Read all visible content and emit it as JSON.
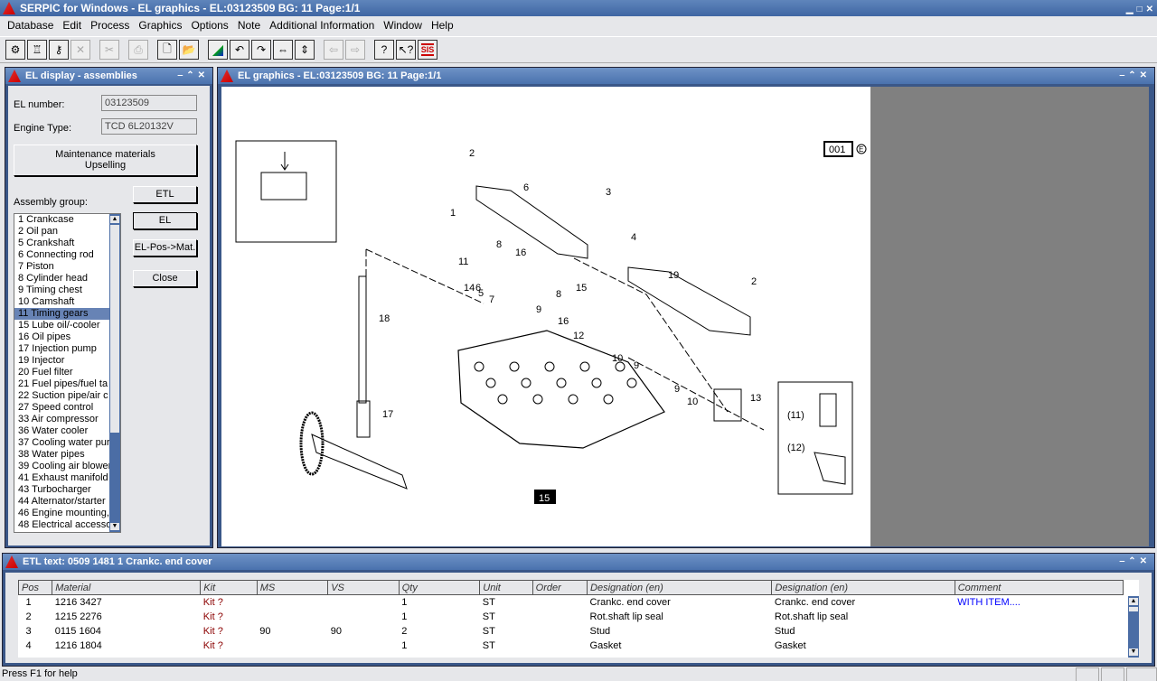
{
  "app": {
    "title": "SERPIC for Windows - EL graphics  -  EL:03123509 BG: 11  Page:1/1"
  },
  "menu": [
    "Database",
    "Edit",
    "Process",
    "Graphics",
    "Options",
    "Note",
    "Additional Information",
    "Window",
    "Help"
  ],
  "toolbar": [
    {
      "icon": "engine-icon",
      "glyph": "⚙",
      "disabled": false
    },
    {
      "icon": "piston-icon",
      "glyph": "♖",
      "disabled": false
    },
    {
      "icon": "wrench-icon",
      "glyph": "⚷",
      "disabled": false
    },
    {
      "icon": "close-icon",
      "glyph": "✕",
      "disabled": true
    },
    {
      "sep": true
    },
    {
      "icon": "cut-icon",
      "glyph": "✂",
      "disabled": true
    },
    {
      "sep": true
    },
    {
      "icon": "print-icon",
      "glyph": "⎙",
      "disabled": true
    },
    {
      "sep": true
    },
    {
      "icon": "new-document-icon",
      "glyph": "🗋",
      "disabled": false
    },
    {
      "icon": "open-folder-icon",
      "glyph": "📂",
      "disabled": false
    },
    {
      "sep": true
    },
    {
      "icon": "rainbow-icon",
      "glyph": "◢",
      "disabled": false
    },
    {
      "icon": "undo-icon",
      "glyph": "↶",
      "disabled": false
    },
    {
      "icon": "redo-icon",
      "glyph": "↷",
      "disabled": false
    },
    {
      "icon": "fit-width-icon",
      "glyph": "⇔",
      "disabled": false
    },
    {
      "icon": "fit-height-icon",
      "glyph": "⇕",
      "disabled": false
    },
    {
      "sep": true
    },
    {
      "icon": "back-arrow-icon",
      "glyph": "⇦",
      "disabled": true
    },
    {
      "icon": "forward-arrow-icon",
      "glyph": "⇨",
      "disabled": true
    },
    {
      "sep": true
    },
    {
      "icon": "help-icon",
      "glyph": "?",
      "disabled": false
    },
    {
      "icon": "context-help-icon",
      "glyph": "↖?",
      "disabled": false
    },
    {
      "icon": "sis-icon",
      "glyph": "SIS",
      "disabled": false
    }
  ],
  "left": {
    "title": "EL display - assemblies",
    "el_number_label": "EL number:",
    "el_number": "03123509",
    "engine_type_label": "Engine Type:",
    "engine_type": "TCD 6L20132V",
    "maint_line1": "Maintenance materials",
    "maint_line2": "Upselling",
    "assembly_label": "Assembly group:",
    "btn_etl": "ETL",
    "btn_el": "EL",
    "btn_elpos": "EL-Pos->Mat.",
    "btn_close": "Close",
    "selected": "11 Timing gears",
    "groups": [
      "1 Crankcase",
      "2 Oil pan",
      "5 Crankshaft",
      "6 Connecting rod",
      "7 Piston",
      "8 Cylinder head",
      "9 Timing chest",
      "10 Camshaft",
      "11 Timing gears",
      "15 Lube oil/-cooler",
      "16 Oil pipes",
      "17 Injection pump",
      "19 Injector",
      "20 Fuel filter",
      "21 Fuel pipes/fuel ta",
      "22 Suction pipe/air c",
      "27 Speed control",
      "33 Air compressor",
      "36 Water cooler",
      "37 Cooling water pur",
      "38 Water pipes",
      "39 Cooling air blower",
      "41 Exhaust manifold",
      "43 Turbocharger",
      "44 Alternator/starter",
      "46 Engine mounting,",
      "48 Electrical accesso"
    ]
  },
  "graphics": {
    "title": "EL graphics  -  EL:03123509 BG: 11  Page:1/1",
    "page_tag": "001",
    "page_tag_suffix": "E",
    "sheet_tag": "15",
    "callouts": [
      "2",
      "6",
      "3",
      "1",
      "4",
      "11",
      "14",
      "6",
      "8",
      "16",
      "7",
      "5",
      "9",
      "8",
      "15",
      "19",
      "2",
      "16",
      "12",
      "18",
      "10",
      "9",
      "9",
      "10",
      "13",
      "17"
    ],
    "inset_labels": [
      "(11)",
      "(12)"
    ]
  },
  "etl": {
    "title": "ETL text: 0509 1481     1   Crankc. end cover",
    "columns": [
      "Pos",
      "Material",
      "Kit",
      "MS",
      "VS",
      "Qty",
      "Unit",
      "Order",
      "Designation (en)",
      "Designation (en)",
      "Comment"
    ],
    "rows": [
      [
        "1",
        "1216 3427",
        "Kit ?",
        "",
        "",
        "1",
        "ST",
        "",
        "Crankc. end cover",
        "Crankc. end cover",
        "WITH ITEM...."
      ],
      [
        "2",
        "1215 2276",
        "Kit ?",
        "",
        "",
        "1",
        "ST",
        "",
        "Rot.shaft lip seal",
        "Rot.shaft lip seal",
        ""
      ],
      [
        "3",
        "0115 1604",
        "Kit ?",
        "90",
        "90",
        "2",
        "ST",
        "",
        "Stud",
        "Stud",
        ""
      ],
      [
        "4",
        "1216 1804",
        "Kit ?",
        "",
        "",
        "1",
        "ST",
        "",
        "Gasket",
        "Gasket",
        ""
      ]
    ]
  },
  "status": {
    "text": "Press F1 for help"
  },
  "colors": {
    "title_bar": "#3f66a3",
    "selection": "#6783b5",
    "kit_text": "#8b0000",
    "comment_text": "#0000ff",
    "graphics_bg": "#808080"
  }
}
